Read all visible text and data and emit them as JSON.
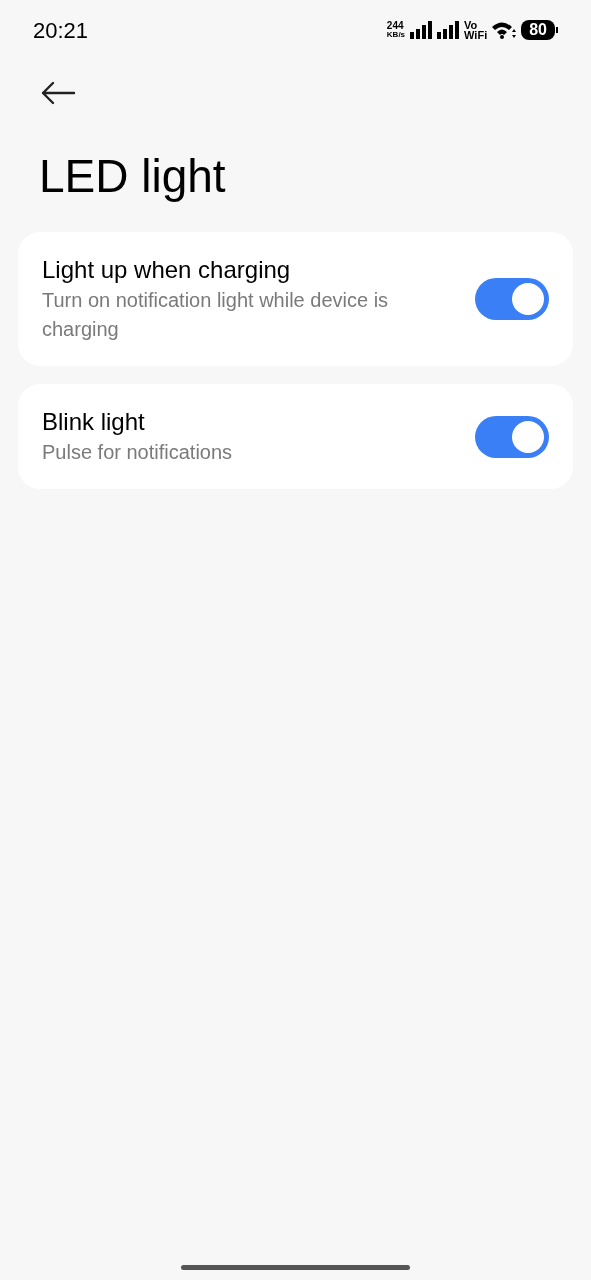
{
  "status_bar": {
    "time": "20:21",
    "speed": "244",
    "speed_unit": "KB/s",
    "vo": "Vo",
    "wifi": "WiFi",
    "battery": "80"
  },
  "title": "LED light",
  "settings": [
    {
      "title": "Light up when charging",
      "subtitle": "Turn on notification light while device is charging",
      "on": true
    },
    {
      "title": "Blink light",
      "subtitle": "Pulse for notifications",
      "on": true
    }
  ]
}
